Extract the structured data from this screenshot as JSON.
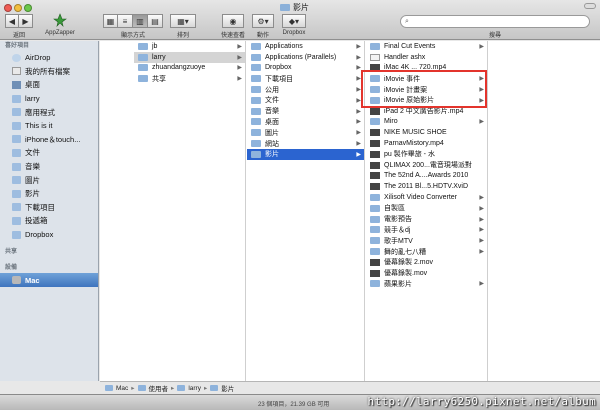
{
  "window": {
    "title": "影片"
  },
  "toolbar": {
    "back_label": "返回",
    "appzapper_label": "AppZapper",
    "view_label": "顯示方式",
    "arrange_label": "排列",
    "quicklook_label": "快速查看",
    "action_label": "動作",
    "dropbox_label": "Dropbox",
    "search_label": "搜尋",
    "search_placeholder": ""
  },
  "sidebar": {
    "favorites_header": "喜好項目",
    "favorites": [
      {
        "label": "AirDrop",
        "icon": "airdrop-icon"
      },
      {
        "label": "我的所有檔案",
        "icon": "all-files-icon"
      },
      {
        "label": "桌面",
        "icon": "desktop-icon"
      },
      {
        "label": "larry",
        "icon": "home-icon"
      },
      {
        "label": "應用程式",
        "icon": "applications-icon"
      },
      {
        "label": "This is it",
        "icon": "folder-icon"
      },
      {
        "label": "iPhone＆touch...",
        "icon": "folder-icon"
      },
      {
        "label": "文件",
        "icon": "documents-icon"
      },
      {
        "label": "音樂",
        "icon": "music-icon"
      },
      {
        "label": "圖片",
        "icon": "pictures-icon"
      },
      {
        "label": "影片",
        "icon": "movies-icon"
      },
      {
        "label": "下載項目",
        "icon": "downloads-icon"
      },
      {
        "label": "投遞箱",
        "icon": "dropbox-folder-icon"
      },
      {
        "label": "Dropbox",
        "icon": "dropbox-icon"
      }
    ],
    "shared_header": "共享",
    "devices_header": "設備",
    "devices": [
      {
        "label": "Mac",
        "icon": "computer-icon",
        "selected": true
      }
    ]
  },
  "columns": [
    {
      "items": [
        {
          "label": "jb",
          "arrow": true
        },
        {
          "label": "larry",
          "arrow": true,
          "state": "hl"
        },
        {
          "label": "zhuandangzuoye",
          "arrow": true
        },
        {
          "label": "共享",
          "arrow": true
        }
      ]
    },
    {
      "items": [
        {
          "label": "Applications",
          "arrow": true
        },
        {
          "label": "Applications (Parallels)",
          "arrow": true
        },
        {
          "label": "Dropbox",
          "arrow": true
        },
        {
          "label": "下載項目",
          "arrow": true
        },
        {
          "label": "公用",
          "arrow": true
        },
        {
          "label": "文件",
          "arrow": true
        },
        {
          "label": "音樂",
          "arrow": true
        },
        {
          "label": "桌面",
          "arrow": true
        },
        {
          "label": "圖片",
          "arrow": true
        },
        {
          "label": "網站",
          "arrow": true
        },
        {
          "label": "影片",
          "arrow": true,
          "state": "sel"
        }
      ]
    },
    {
      "items": [
        {
          "label": "Final Cut Events",
          "arrow": true,
          "type": "folder"
        },
        {
          "label": "Handler ashx",
          "arrow": false,
          "type": "file"
        },
        {
          "label": "iMac 4K ... 720.mp4",
          "arrow": false,
          "type": "movie"
        },
        {
          "label": "iMovie 事件",
          "arrow": true,
          "type": "folder"
        },
        {
          "label": "iMovie 計畫案",
          "arrow": true,
          "type": "folder"
        },
        {
          "label": "iMovie 原始影片",
          "arrow": true,
          "type": "folder"
        },
        {
          "label": "iPad 2 中文廣告影片.mp4",
          "arrow": false,
          "type": "movie"
        },
        {
          "label": "Miro",
          "arrow": true,
          "type": "folder"
        },
        {
          "label": "NIKE MUSIC SHOE",
          "arrow": false,
          "type": "movie"
        },
        {
          "label": "ParnavMistory.mp4",
          "arrow": false,
          "type": "movie"
        },
        {
          "label": "pu 製作畢旅 - 水",
          "arrow": false,
          "type": "movie"
        },
        {
          "label": "QLIMAX 200...電音現場派對",
          "arrow": false,
          "type": "movie"
        },
        {
          "label": "The 52nd A....Awards 2010",
          "arrow": false,
          "type": "movie"
        },
        {
          "label": "The 2011 Bl...5.HDTV.XviD",
          "arrow": false,
          "type": "movie"
        },
        {
          "label": "Xilisoft Video Converter",
          "arrow": true,
          "type": "folder"
        },
        {
          "label": "自製區",
          "arrow": true,
          "type": "folder"
        },
        {
          "label": "電影預告",
          "arrow": true,
          "type": "folder"
        },
        {
          "label": "競手＆dj",
          "arrow": true,
          "type": "folder"
        },
        {
          "label": "歌手MTV",
          "arrow": true,
          "type": "folder"
        },
        {
          "label": "舞的亂七八糟",
          "arrow": true,
          "type": "folder"
        },
        {
          "label": "優幕錄製 2.mov",
          "arrow": false,
          "type": "movie"
        },
        {
          "label": "優幕錄製.mov",
          "arrow": false,
          "type": "movie"
        },
        {
          "label": "蘋果影片",
          "arrow": true,
          "type": "folder"
        }
      ]
    }
  ],
  "pathbar": [
    "Mac",
    "使用者",
    "larry",
    "影片"
  ],
  "status": {
    "text": "23 個項目，21.39 GB 可用"
  },
  "watermark": "http://larry6250.pixnet.net/album",
  "colors": {
    "accent": "#2b64d0",
    "annotation": "#e3342c"
  }
}
